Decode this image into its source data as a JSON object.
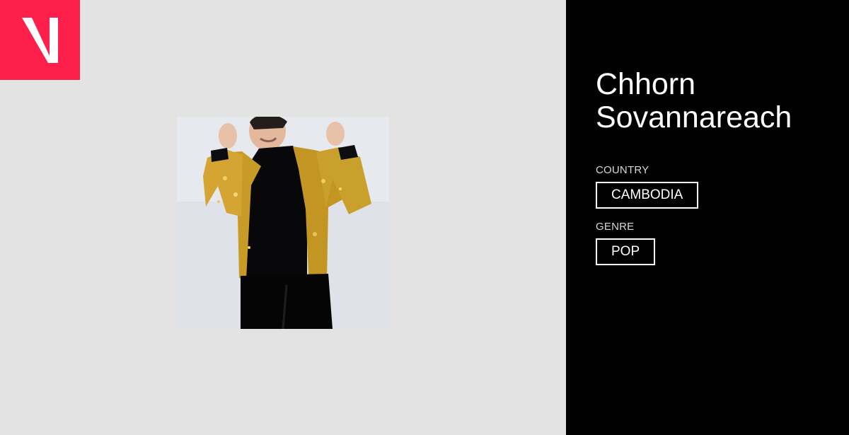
{
  "artist": {
    "name_line1": "Chhorn",
    "name_line2": "Sovannareach"
  },
  "details": {
    "country_label": "COUNTRY",
    "country_value": "CAMBODIA",
    "genre_label": "GENRE",
    "genre_value": "POP"
  },
  "colors": {
    "brand": "#ff1f4b",
    "left_background": "#e3e3e3",
    "right_background": "#000000"
  },
  "icons": {
    "logo": "v-logo-icon"
  }
}
